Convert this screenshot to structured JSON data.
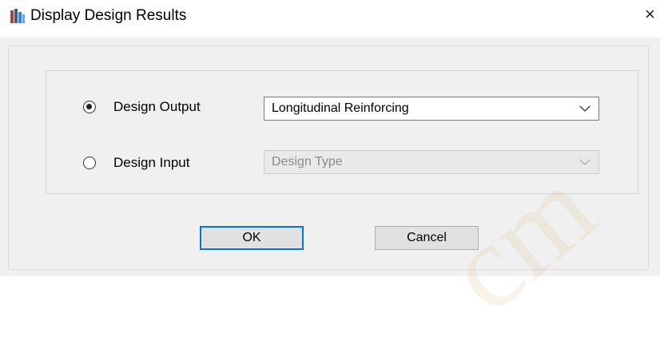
{
  "window": {
    "title": "Display Design Results",
    "close_glyph": "×",
    "icon": "app-icon"
  },
  "group": {
    "design_output": {
      "label": "Design Output",
      "selected": true,
      "dropdown_value": "Longitudinal Reinforcing"
    },
    "design_input": {
      "label": "Design Input",
      "selected": false,
      "dropdown_value": "Design Type",
      "disabled": true
    }
  },
  "buttons": {
    "ok_label": "OK",
    "cancel_label": "Cancel"
  },
  "watermark": "cm"
}
